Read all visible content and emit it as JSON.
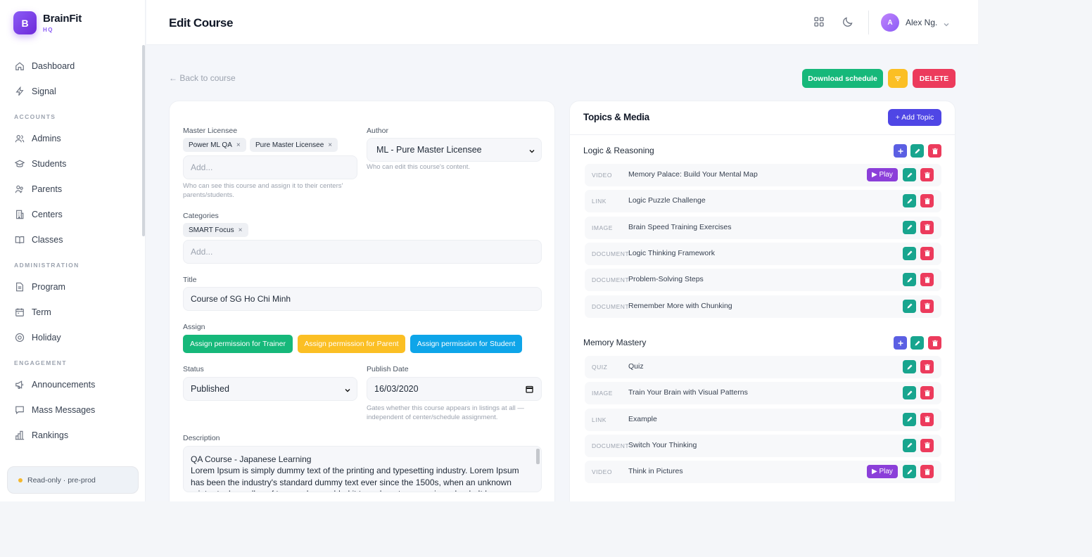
{
  "brand": {
    "initial": "B",
    "name": "BrainFit",
    "sub": "HQ"
  },
  "sidebar": {
    "items_top": [
      {
        "label": "Dashboard",
        "icon": "home-icon"
      },
      {
        "label": "Signal",
        "icon": "bolt-icon"
      }
    ],
    "section_accounts": "ACCOUNTS",
    "accounts": [
      {
        "label": "Admins"
      },
      {
        "label": "Students"
      },
      {
        "label": "Parents"
      },
      {
        "label": "Centers"
      },
      {
        "label": "Classes"
      }
    ],
    "section_admin": "ADMINISTRATION",
    "admin": [
      {
        "label": "Program"
      },
      {
        "label": "Term"
      },
      {
        "label": "Holiday"
      }
    ],
    "section_engagement": "ENGAGEMENT",
    "engagement": [
      {
        "label": "Announcements"
      },
      {
        "label": "Mass Messages"
      },
      {
        "label": "Rankings"
      }
    ],
    "env_label": "Read-only · pre-prod"
  },
  "header": {
    "title": "Edit Course",
    "user_initial": "A",
    "user_name": "Alex Ng."
  },
  "actions": {
    "back": "← Back to course",
    "download": "Download schedule",
    "delete": "DELETE"
  },
  "form": {
    "master_licensee_label": "Master Licensee",
    "master_chips": [
      "Power ML QA",
      "Pure Master Licensee"
    ],
    "add_placeholder": "Add...",
    "master_hint": "Who can see this course and assign it to their centers' parents/students.",
    "author_label": "Author",
    "author_value": "ML - Pure Master Licensee",
    "author_hint": "Who can edit this course's content.",
    "categories_label": "Categories",
    "category_chips": [
      "SMART Focus"
    ],
    "title_label": "Title",
    "title_value": "Course of SG Ho Chi Minh",
    "assign_label": "Assign",
    "assign_trainer": "Assign permission for Trainer",
    "assign_parent": "Assign permission for Parent",
    "assign_student": "Assign permission for Student",
    "status_label": "Status",
    "status_value": "Published",
    "publish_label": "Publish Date",
    "publish_value": "16/03/2020",
    "publish_hint": "Gates whether this course appears in listings at all — independent of center/schedule assignment.",
    "description_label": "Description",
    "description_line1": "QA Course - Japanese Learning",
    "description_body": "Lorem Ipsum is simply dummy text of the printing and typesetting industry. Lorem Ipsum has been the industry's standard dummy text ever since the 1500s, when an unknown printer took a galley of type and scrambled it to make a type specimen book. It has"
  },
  "topics": {
    "title": "Topics & Media",
    "add_label": "+ Add Topic",
    "play_label": "▶ Play",
    "groups": [
      {
        "name": "Logic & Reasoning",
        "items": [
          {
            "type": "VIDEO",
            "name": "Memory Palace: Build Your Mental Map",
            "play": true
          },
          {
            "type": "LINK",
            "name": "Logic Puzzle Challenge"
          },
          {
            "type": "IMAGE",
            "name": "Brain Speed Training Exercises"
          },
          {
            "type": "DOCUMENT",
            "name": "Logic Thinking Framework"
          },
          {
            "type": "DOCUMENT",
            "name": "Problem-Solving Steps"
          },
          {
            "type": "DOCUMENT",
            "name": "Remember More with Chunking"
          }
        ]
      },
      {
        "name": "Memory Mastery",
        "items": [
          {
            "type": "QUIZ",
            "name": "Quiz"
          },
          {
            "type": "IMAGE",
            "name": "Train Your Brain with Visual Patterns"
          },
          {
            "type": "LINK",
            "name": "Example"
          },
          {
            "type": "DOCUMENT",
            "name": "Switch Your Thinking"
          },
          {
            "type": "VIDEO",
            "name": "Think in Pictures",
            "play": true
          }
        ]
      }
    ]
  },
  "colors": {
    "accent": "#7c3aed",
    "green": "#16b87a",
    "amber": "#fbbf24",
    "red": "#ec3b5c",
    "blue": "#0ea5e9",
    "indigo": "#4f46e5"
  }
}
